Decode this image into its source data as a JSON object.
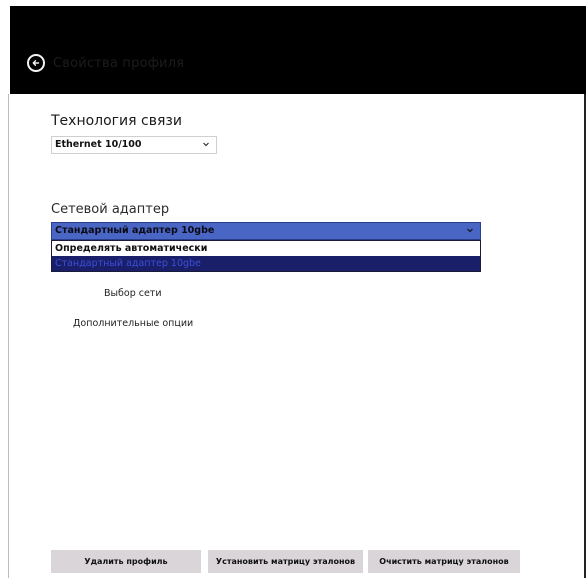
{
  "header": {
    "title": "Свойства профиля"
  },
  "technology": {
    "label": "Технология связи",
    "selected": "Ethernet 10/100"
  },
  "adapter": {
    "label": "Сетевой адаптер",
    "selected": "Стандартный адаптер 10gbe",
    "options": [
      "Определять автоматически",
      "Стандартный адаптер 10gbe"
    ]
  },
  "links": {
    "network": "Выбор сети",
    "options": "Дополнительные опции"
  },
  "buttons": {
    "delete": "Удалить профиль",
    "set_matrix": "Установить матрицу эталонов",
    "clear_matrix": "Очистить матрицу эталонов"
  },
  "colors": {
    "header_bg": "#000000",
    "dropdown_highlight": "#4a66c5",
    "selected_option_bg": "#1a1f6a",
    "button_bg": "#d9d5d8"
  }
}
